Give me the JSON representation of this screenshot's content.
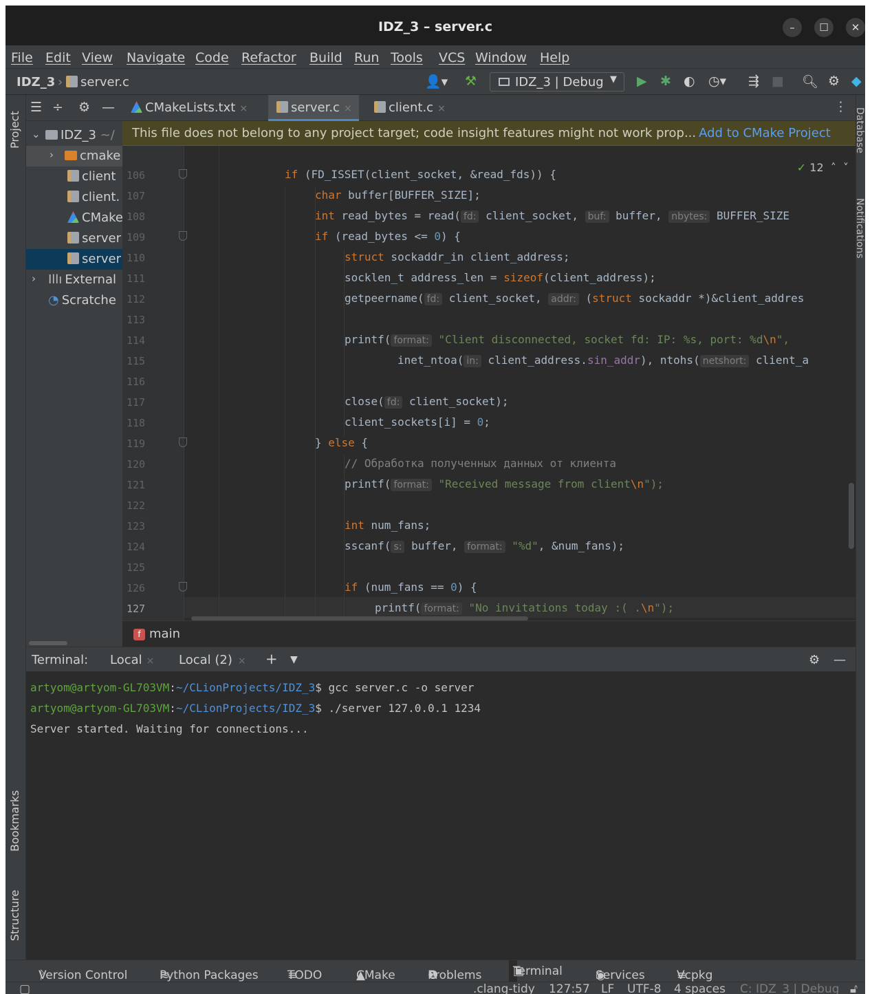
{
  "window": {
    "title": "IDZ_3 – server.c",
    "minimize": "–",
    "maximize": "☐",
    "close": "✕"
  },
  "menu": [
    "File",
    "Edit",
    "View",
    "Navigate",
    "Code",
    "Refactor",
    "Build",
    "Run",
    "Tools",
    "VCS",
    "Window",
    "Help"
  ],
  "nav": {
    "project": "IDZ_3",
    "file": "server.c",
    "run_config": "IDZ_3 | Debug"
  },
  "left_strip": {
    "project": "Project",
    "bookmarks": "Bookmarks",
    "structure": "Structure"
  },
  "right_strip": {
    "database": "Database",
    "notifications": "Notifications"
  },
  "project_tree": [
    {
      "label": "IDZ_3",
      "suffix": "~/",
      "caret": "⌄"
    },
    {
      "label": "cmake",
      "caret": "›"
    },
    {
      "label": "client"
    },
    {
      "label": "client."
    },
    {
      "label": "CMake"
    },
    {
      "label": "server"
    },
    {
      "label": "server"
    },
    {
      "label": "External",
      "caret": "›"
    },
    {
      "label": "Scratche"
    }
  ],
  "tabs": [
    "CMakeLists.txt",
    "server.c",
    "client.c"
  ],
  "tab_close": "×",
  "banner": {
    "message": "This file does not belong to any project target; code insight features might not work prop...",
    "action": "Add to CMake Project"
  },
  "editor": {
    "inspections": "12",
    "current_line": "127",
    "line_numbers": [
      "106",
      "107",
      "108",
      "109",
      "110",
      "111",
      "112",
      "113",
      "114",
      "115",
      "116",
      "117",
      "118",
      "119",
      "120",
      "121",
      "122",
      "123",
      "124",
      "125",
      "126",
      "127"
    ],
    "lines": {
      "l106": [
        "if",
        " (FD_ISSET(client_socket, &read_fds)) {"
      ],
      "l107": [
        "char",
        " buffer[BUFFER_SIZE];"
      ],
      "l108": [
        "int",
        " read_bytes = read(",
        "fd:",
        " client_socket, ",
        "buf:",
        " buffer, ",
        "nbytes:",
        " BUFFER_SIZE"
      ],
      "l109": [
        "if",
        " (read_bytes <= ",
        "0",
        ") {"
      ],
      "l110": [
        "struct",
        " sockaddr_in client_address;"
      ],
      "l111": [
        "socklen_t address_len = ",
        "sizeof",
        "(client_address);"
      ],
      "l112": [
        "getpeername(",
        "fd:",
        " client_socket, ",
        "addr:",
        " (",
        "struct",
        " sockaddr *)&client_addres"
      ],
      "l114": [
        "printf(",
        "format:",
        " ",
        "\"Client disconnected, socket fd: IP: %s, port: %d",
        "\\n",
        "\","
      ],
      "l115": [
        "inet_ntoa(",
        "in:",
        " client_address.",
        "sin_addr",
        "), ntohs(",
        "netshort:",
        " client_a"
      ],
      "l117": [
        "close(",
        "fd:",
        " client_socket);"
      ],
      "l118": [
        "client_sockets[i] = ",
        "0",
        ";"
      ],
      "l119": [
        "} ",
        "else",
        " {"
      ],
      "l120": [
        "// Обработка полученных данных от клиента"
      ],
      "l121": [
        "printf(",
        "format:",
        " ",
        "\"Received message from client",
        "\\n",
        "\");"
      ],
      "l123": [
        "int",
        " num_fans;"
      ],
      "l124": [
        "sscanf(",
        "s:",
        " buffer, ",
        "format:",
        " ",
        "\"%d\"",
        ", &num_fans);"
      ],
      "l126": [
        "if",
        " (num_fans == ",
        "0",
        ") {"
      ],
      "l127": [
        "printf(",
        "format:",
        " ",
        "\"No invitations today :( .",
        "\\n",
        "\");"
      ]
    }
  },
  "breadcrumb": {
    "icon": "f",
    "function": "main"
  },
  "terminal": {
    "label": "Terminal:",
    "tabs": [
      "Local",
      "Local (2)"
    ],
    "add": "+",
    "lines": [
      {
        "user": "artyom@artyom-GL703VM",
        "path": "~/CLionProjects/IDZ_3",
        "prompt": "$ ",
        "cmd": "gcc server.c -o server"
      },
      {
        "user": "artyom@artyom-GL703VM",
        "path": "~/CLionProjects/IDZ_3",
        "prompt": "$ ",
        "cmd": "./server 127.0.0.1 1234"
      }
    ],
    "output": "Server started. Waiting for connections..."
  },
  "tool_windows": [
    "Version Control",
    "Python Packages",
    "TODO",
    "CMake",
    "Problems",
    "Terminal",
    "Services",
    "Vcpkg"
  ],
  "status": {
    "linter": ".clang-tidy",
    "position": "127:57",
    "line_ending": "LF",
    "encoding": "UTF-8",
    "indent": "4 spaces",
    "context": "C: IDZ_3 | Debug"
  }
}
